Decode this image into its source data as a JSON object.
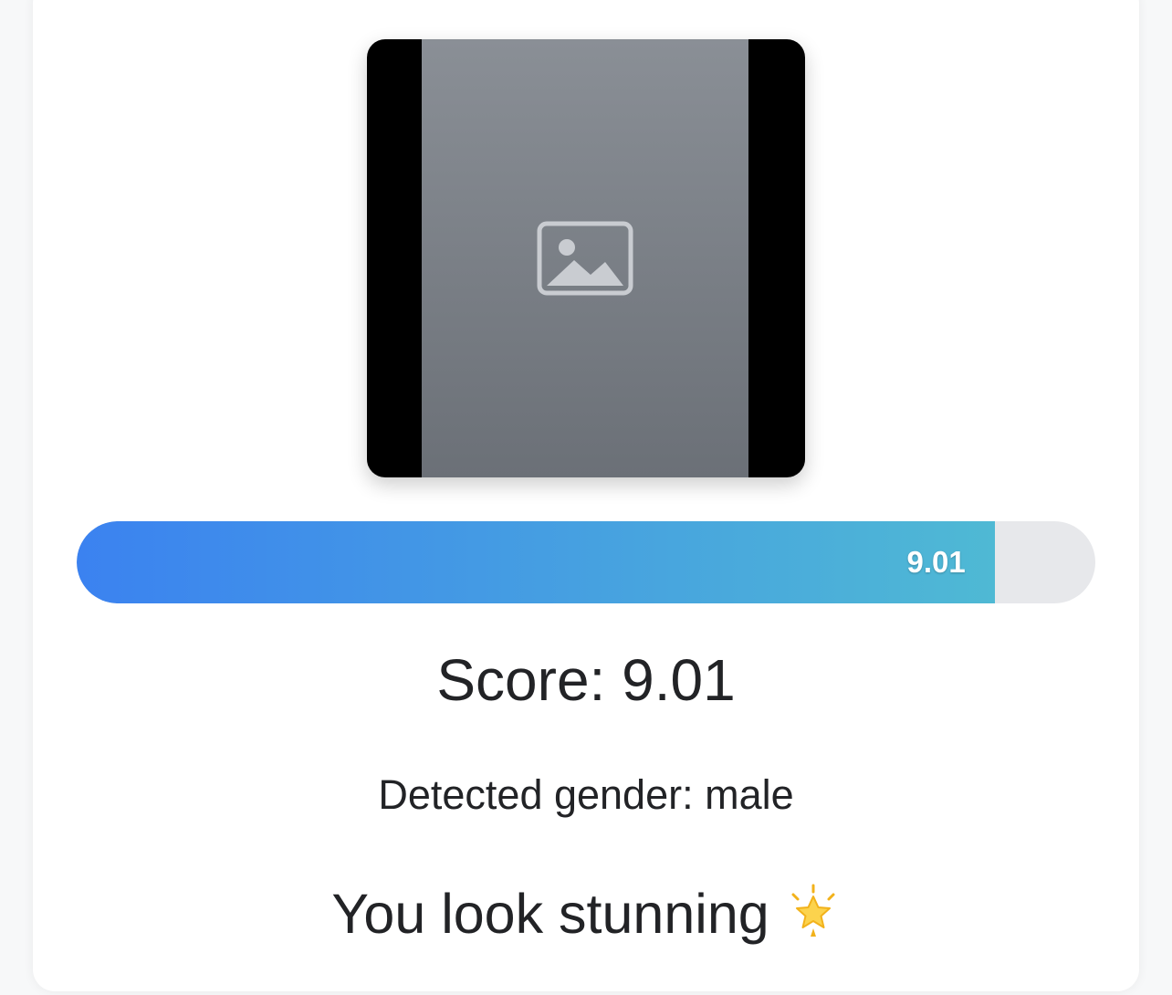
{
  "photo": {
    "placeholder_note": "Uploaded portrait photo (not reproduced)"
  },
  "score_bar": {
    "value_label": "9.01",
    "fill_fraction": 0.901,
    "fill_color_start": "#3b82f0",
    "fill_color_end": "#4fb9d4",
    "track_color": "#e7e8eb"
  },
  "result": {
    "score_text": "Score: 9.01",
    "gender_text": "Detected gender: male",
    "message_text": "You look stunning",
    "message_icon": "glowing-star-icon"
  }
}
